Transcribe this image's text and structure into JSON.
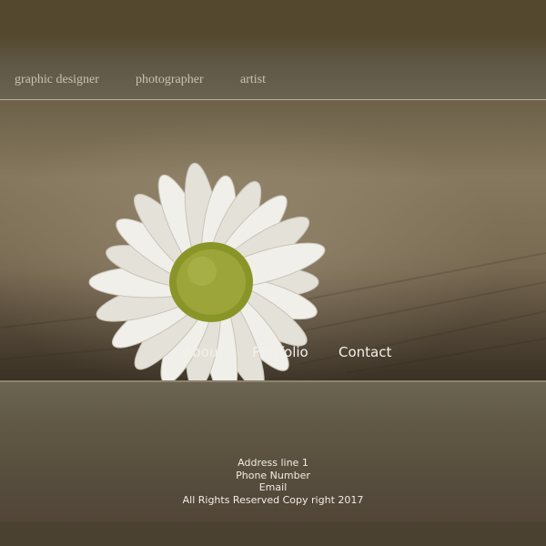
{
  "header": {
    "tagline": [
      "graphic designer",
      "photographer",
      "artist"
    ]
  },
  "hero": {
    "image": "white-daisy-on-wood-photo",
    "nav": [
      "About",
      "Portfolio",
      "Contact"
    ]
  },
  "footer": {
    "address": "Address line 1",
    "phone": "Phone Number",
    "email": "Email",
    "copyright": "All Rights Reserved Copy right 2017"
  },
  "colors": {
    "background": "#4e4636",
    "header_text": "#c9c2b2",
    "nav_text": "#f4f1ea",
    "footer_text": "#f1ede4",
    "divider": "#b9b29f"
  }
}
